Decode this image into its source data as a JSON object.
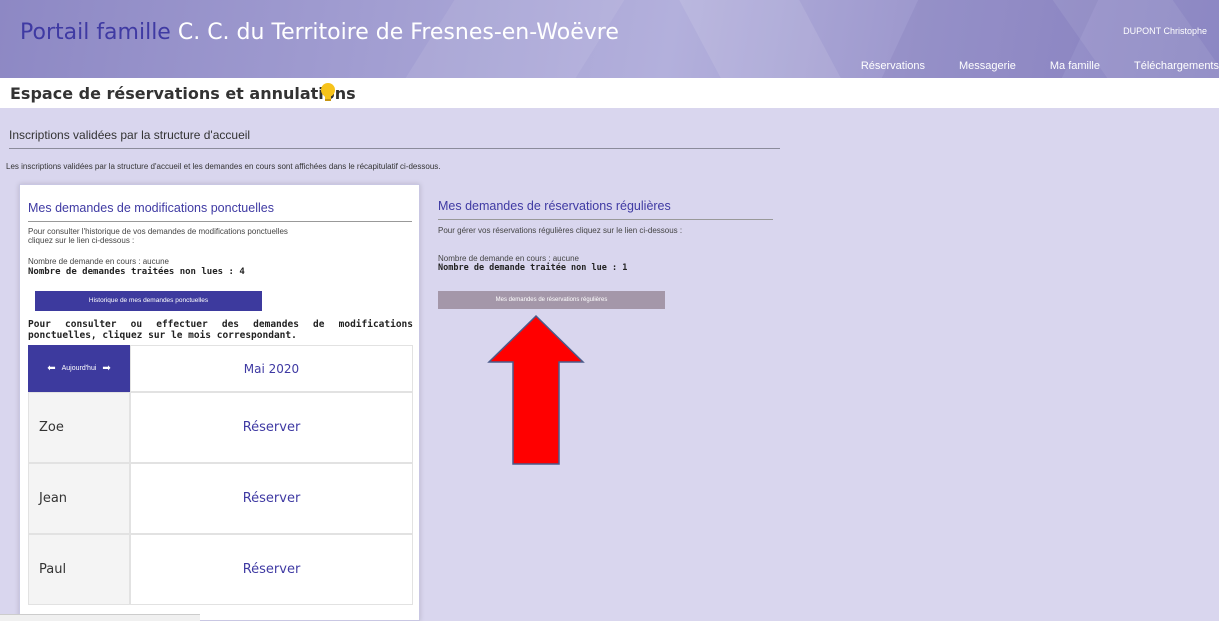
{
  "header": {
    "brand": "Portail famille",
    "organization": "C. C. du Territoire de Fresnes-en-Woëvre",
    "user": "DUPONT Christophe",
    "nav": [
      "Réservations",
      "Messagerie",
      "Ma famille",
      "Téléchargements"
    ]
  },
  "page": {
    "title": "Espace de réservations et annulations"
  },
  "section": {
    "title": "Inscriptions validées par la structure d'accueil",
    "info": "Les inscriptions validées par la structure d'accueil et les demandes en cours  sont affichées dans le récapitulatif ci-dessous."
  },
  "ponctuelles": {
    "title": "Mes demandes de modifications ponctuelles",
    "intro_line1": "Pour consulter l'historique de vos demandes de modifications ponctuelles",
    "intro_line2": "cliquez sur le lien ci-dessous :",
    "pending": "Nombre de demande en cours : aucune",
    "unread": "Nombre de demandes traitées non lues : 4",
    "history_button": "Historique de mes demandes ponctuelles",
    "consult": "Pour consulter ou effectuer des demandes de modifications ponctuelles, cliquez sur le mois correspondant."
  },
  "calendar": {
    "today_label": "Aujourd'hui",
    "month": "Mai 2020",
    "rows": [
      {
        "name": "Zoe",
        "action": "Réserver"
      },
      {
        "name": "Jean",
        "action": "Réserver"
      },
      {
        "name": "Paul",
        "action": "Réserver"
      }
    ]
  },
  "regulieres": {
    "title": "Mes demandes de réservations régulières",
    "intro": "Pour gérer vos réservations régulières cliquez sur le lien ci-dessous :",
    "pending": "Nombre de demande en cours : aucune",
    "unread": "Nombre de demande traitée non lue : 1",
    "button": "Mes demandes de réservations régulières"
  },
  "colors": {
    "accent": "#3d3a9e",
    "background": "#d9d6ee",
    "arrow": "#ff0000"
  },
  "icons": {
    "bulb": "lightbulb-icon",
    "arrow": "red-up-arrow-annotation"
  }
}
